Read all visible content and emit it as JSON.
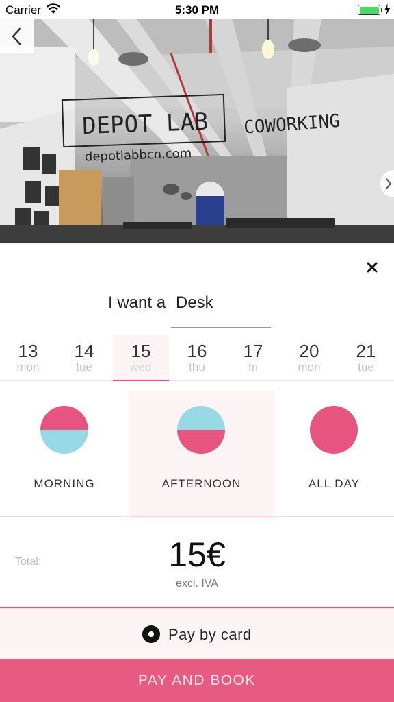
{
  "status_bar": {
    "carrier": "Carrier",
    "time": "5:30 PM",
    "battery_level": 1.0
  },
  "hero": {
    "sign_logo": "DEPOT LAB",
    "sign_tagline": "COWORKING",
    "sign_url": "depotlabbcn.com",
    "back_icon": "chevron-left-icon",
    "next_icon": "chevron-right-icon"
  },
  "colors": {
    "accent": "#e75480",
    "accent_light": "#fdf4f6",
    "light_blue": "#98d9e6",
    "pink": "#e75480",
    "button": "#e75a82"
  },
  "close_icon": "close-icon",
  "want": {
    "prefix": "I want a",
    "selected": "Desk"
  },
  "dates": [
    {
      "day": "13",
      "dow": "mon",
      "selected": false
    },
    {
      "day": "14",
      "dow": "tue",
      "selected": false
    },
    {
      "day": "15",
      "dow": "wed",
      "selected": true
    },
    {
      "day": "16",
      "dow": "thu",
      "selected": false
    },
    {
      "day": "17",
      "dow": "fri",
      "selected": false
    },
    {
      "day": "20",
      "dow": "mon",
      "selected": false
    },
    {
      "day": "21",
      "dow": "tue",
      "selected": false
    }
  ],
  "slots": [
    {
      "label": "MORNING",
      "icon": "morning-half-circle-icon",
      "selected": false
    },
    {
      "label": "AFTERNOON",
      "icon": "afternoon-half-circle-icon",
      "selected": true
    },
    {
      "label": "ALL DAY",
      "icon": "all-day-circle-icon",
      "selected": false
    }
  ],
  "total": {
    "label": "Total:",
    "price": "15€",
    "note": "excl. IVA"
  },
  "payment": {
    "method_label": "Pay by card",
    "method_selected": true,
    "button_label": "PAY AND BOOK"
  }
}
